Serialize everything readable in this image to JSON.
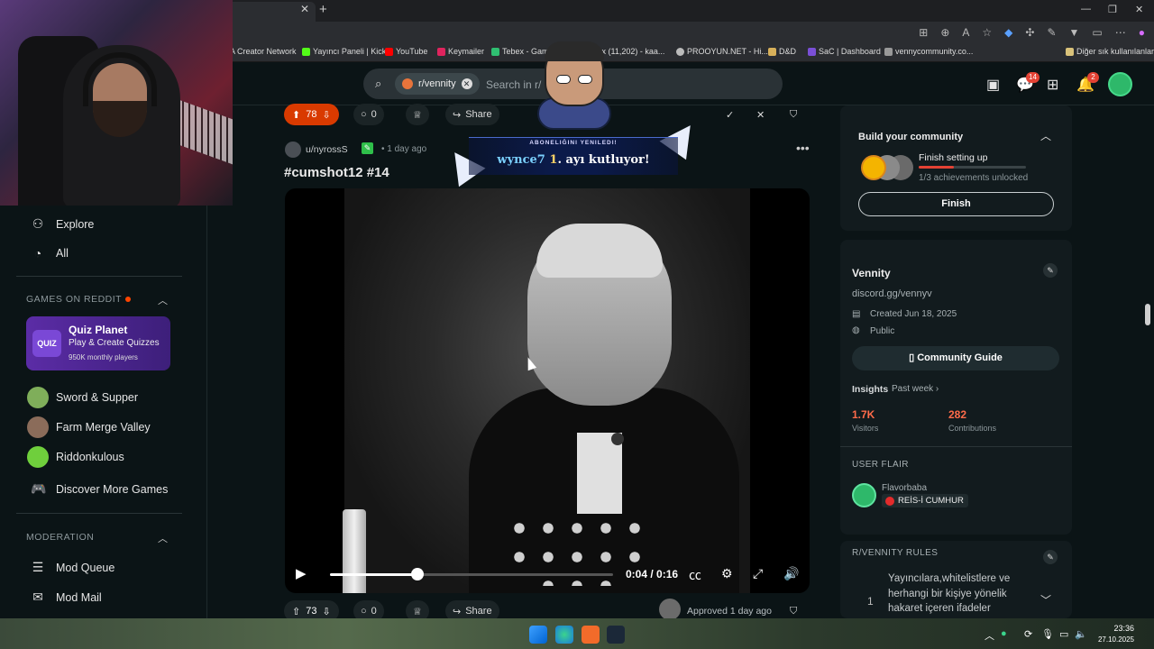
{
  "browser": {
    "bookmarks": [
      {
        "label": "A Creator Network",
        "color": "#1e1f22"
      },
      {
        "label": "Yayıncı Paneli | Kick",
        "color": "#53fc18"
      },
      {
        "label": "YouTube",
        "color": "#ff0000"
      },
      {
        "label": "Keymailer",
        "color": "#e0245e"
      },
      {
        "label": "Tebex - Gaming S...",
        "color": "#2fbf71"
      },
      {
        "label": "Inbox (11,202) - kaa...",
        "color": "#ffffff"
      },
      {
        "label": "PROOYUN.NET - Hi...",
        "color": "#bbbbbb"
      },
      {
        "label": "D&D",
        "color": "#d7b05a"
      },
      {
        "label": "SaC | Dashboard",
        "color": "#7a4fd6"
      },
      {
        "label": "vennycommunity.co...",
        "color": "#999999"
      }
    ],
    "other_bookmarks": "Diğer sık kullanılanlar"
  },
  "header": {
    "subreddit_chip": "r/vennity",
    "search_placeholder": "Search in r/",
    "chat_badge": "14",
    "notifications_badge": "2"
  },
  "overlay": {
    "banner_top": "ABONELIĞINI YENILEDI!",
    "banner_user": "wynce7",
    "banner_num": "1",
    "banner_rest": ". ayı kutluyor!"
  },
  "sidebar": {
    "explore": "Explore",
    "all": "All",
    "games_header": "GAMES ON REDDIT",
    "quiz_logo": "QUIZ",
    "quiz_title": "Quiz Planet",
    "quiz_sub": "Play & Create Quizzes",
    "quiz_players": "950K monthly players",
    "games": [
      "Sword & Supper",
      "Farm Merge Valley",
      "Riddonkulous"
    ],
    "discover": "Discover More Games",
    "moderation_header": "MODERATION",
    "mod_queue": "Mod Queue",
    "mod_mail": "Mod Mail"
  },
  "prev_post": {
    "votes": "78",
    "comments": "0",
    "share": "Share"
  },
  "post": {
    "user": "u/nyrossS",
    "time": "• 1 day ago",
    "title": "#cumshot12 #14",
    "video_time": "0:04 / 0:16",
    "video_progress": 0.31,
    "votes": "73",
    "comments": "0",
    "share": "Share",
    "approved": "Approved 1 day ago"
  },
  "right": {
    "build_title": "Build your community",
    "setup_title": "Finish setting up",
    "setup_sub": "1/3 achievements unlocked",
    "setup_progress": 0.33,
    "finish_btn": "Finish",
    "community_name": "Vennity",
    "community_desc": "discord.gg/vennyv",
    "created": "Created Jun 18, 2025",
    "visibility": "Public",
    "guide_btn": "Community Guide",
    "insights": "Insights",
    "insights_period": "Past week ›",
    "visitors_val": "1.7K",
    "visitors_lbl": "Visitors",
    "contrib_val": "282",
    "contrib_lbl": "Contributions",
    "user_flair_h": "USER FLAIR",
    "flair_user": "Flavorbaba",
    "flair_tag": "REİS-İ CUMHUR",
    "rules_h": "R/VENNITY RULES",
    "rule_num": "1",
    "rule_text": "Yayıncılara,whitelistlere ve herhangi bir kişiye yönelik hakaret içeren ifadeler"
  },
  "taskbar": {
    "time": "23:36",
    "date": "27.10.2025"
  }
}
